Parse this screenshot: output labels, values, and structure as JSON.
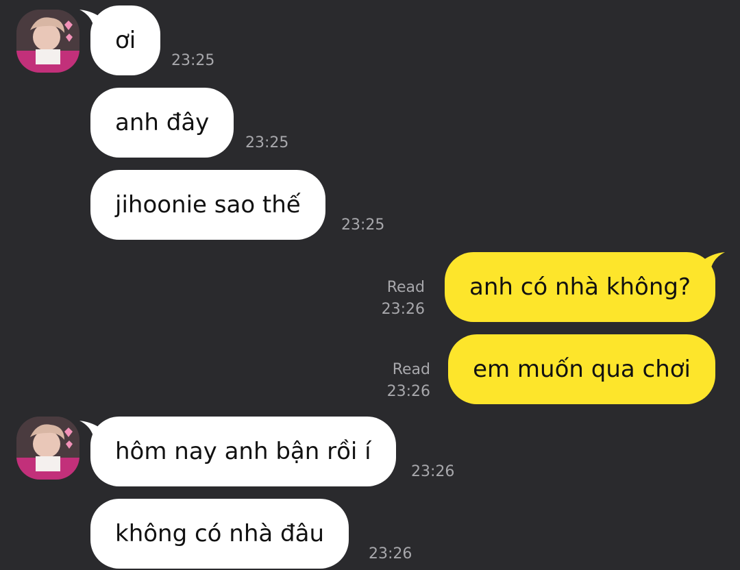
{
  "colors": {
    "background": "#2a2a2d",
    "incoming_bubble": "#ffffff",
    "outgoing_bubble": "#fde52b",
    "meta_text": "#a8a8ac"
  },
  "messages": [
    {
      "direction": "incoming",
      "text": "ơi",
      "time": "23:25",
      "show_avatar": true
    },
    {
      "direction": "incoming",
      "text": "anh đây",
      "time": "23:25",
      "show_avatar": false
    },
    {
      "direction": "incoming",
      "text": "jihoonie sao thế",
      "time": "23:25",
      "show_avatar": false
    },
    {
      "direction": "outgoing",
      "text": "anh có nhà không?",
      "status": "Read",
      "time": "23:26"
    },
    {
      "direction": "outgoing",
      "text": "em muốn qua chơi",
      "status": "Read",
      "time": "23:26"
    },
    {
      "direction": "incoming",
      "text": "hôm nay anh bận rồi í",
      "time": "23:26",
      "show_avatar": true
    },
    {
      "direction": "incoming",
      "text": "không có nhà đâu",
      "time": "23:26",
      "show_avatar": false
    }
  ]
}
